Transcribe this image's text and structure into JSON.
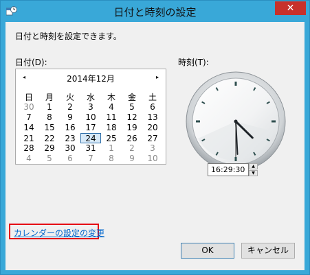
{
  "window": {
    "title": "日付と時刻の設定",
    "close_glyph": "✕"
  },
  "description": "日付と時刻を設定できます。",
  "date_label": "日付(D):",
  "time_label": "時刻(T):",
  "calendar": {
    "prev_glyph": "◂",
    "next_glyph": "▸",
    "month_title": "2014年12月",
    "weekdays": [
      "日",
      "月",
      "火",
      "水",
      "木",
      "金",
      "土"
    ],
    "weeks": [
      [
        "30",
        "1",
        "2",
        "3",
        "4",
        "5",
        "6"
      ],
      [
        "7",
        "8",
        "9",
        "10",
        "11",
        "12",
        "13"
      ],
      [
        "14",
        "15",
        "16",
        "17",
        "18",
        "19",
        "20"
      ],
      [
        "21",
        "22",
        "23",
        "24",
        "25",
        "26",
        "27"
      ],
      [
        "28",
        "29",
        "30",
        "31",
        "1",
        "2",
        "3"
      ],
      [
        "4",
        "5",
        "6",
        "7",
        "8",
        "9",
        "10"
      ]
    ],
    "selected_day": "24"
  },
  "clock": {
    "hours": 16,
    "minutes": 29,
    "seconds": 30
  },
  "time_value": "16:29:30",
  "spin_up_glyph": "▲",
  "spin_down_glyph": "▼",
  "calendar_link": "カレンダーの設定の変更",
  "buttons": {
    "ok": "OK",
    "cancel": "キャンセル"
  },
  "colors": {
    "window_frame": "#39a8d8",
    "close_button": "#c7312b",
    "link": "#0066cc",
    "highlight_box": "#e60012"
  }
}
